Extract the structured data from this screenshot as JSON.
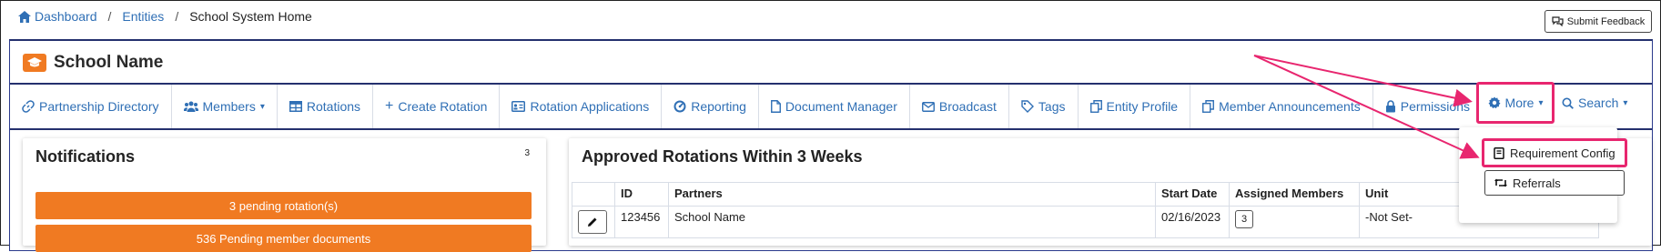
{
  "breadcrumb": {
    "dashboard": "Dashboard",
    "sep1": "/",
    "entities": "Entities",
    "sep2": "/",
    "current": "School System Home"
  },
  "feedback": {
    "label": "Submit Feedback"
  },
  "page": {
    "title": "School Name"
  },
  "nav": [
    {
      "label": "Partnership Directory",
      "icon": "link-icon"
    },
    {
      "label": "Members",
      "icon": "users-icon",
      "caret": true
    },
    {
      "label": "Rotations",
      "icon": "table-icon"
    },
    {
      "label": "Create Rotation",
      "icon": "plus-icon"
    },
    {
      "label": "Rotation Applications",
      "icon": "id-card-icon"
    },
    {
      "label": "Reporting",
      "icon": "gauge-icon"
    },
    {
      "label": "Document Manager",
      "icon": "file-icon"
    },
    {
      "label": "Broadcast",
      "icon": "envelope-icon"
    },
    {
      "label": "Tags",
      "icon": "tags-icon"
    },
    {
      "label": "Entity Profile",
      "icon": "copy-icon"
    },
    {
      "label": "Member Announcements",
      "icon": "copy-icon"
    },
    {
      "label": "Permissions",
      "icon": "lock-icon"
    }
  ],
  "more": {
    "label": "More",
    "caret": "▾"
  },
  "search": {
    "label": "Search",
    "caret": "▾"
  },
  "dropdown": {
    "requirement_config": "Requirement Config",
    "referrals": "Referrals"
  },
  "notifications": {
    "title": "Notifications",
    "count": "3",
    "items": [
      "3 pending rotation(s)",
      "536 Pending member documents"
    ]
  },
  "approved": {
    "title": "Approved Rotations Within 3 Weeks",
    "columns": [
      "",
      "ID",
      "Partners",
      "Start Date",
      "Assigned Members",
      "Unit"
    ],
    "rows": [
      {
        "id": "123456",
        "partners": "School Name",
        "start_date": "02/16/2023",
        "assigned": "3",
        "unit": "-Not Set-"
      }
    ]
  },
  "colors": {
    "accent": "#2f6fb5",
    "brand_orange": "#f07a22",
    "highlight": "#e8266f",
    "navy": "#24306e"
  }
}
